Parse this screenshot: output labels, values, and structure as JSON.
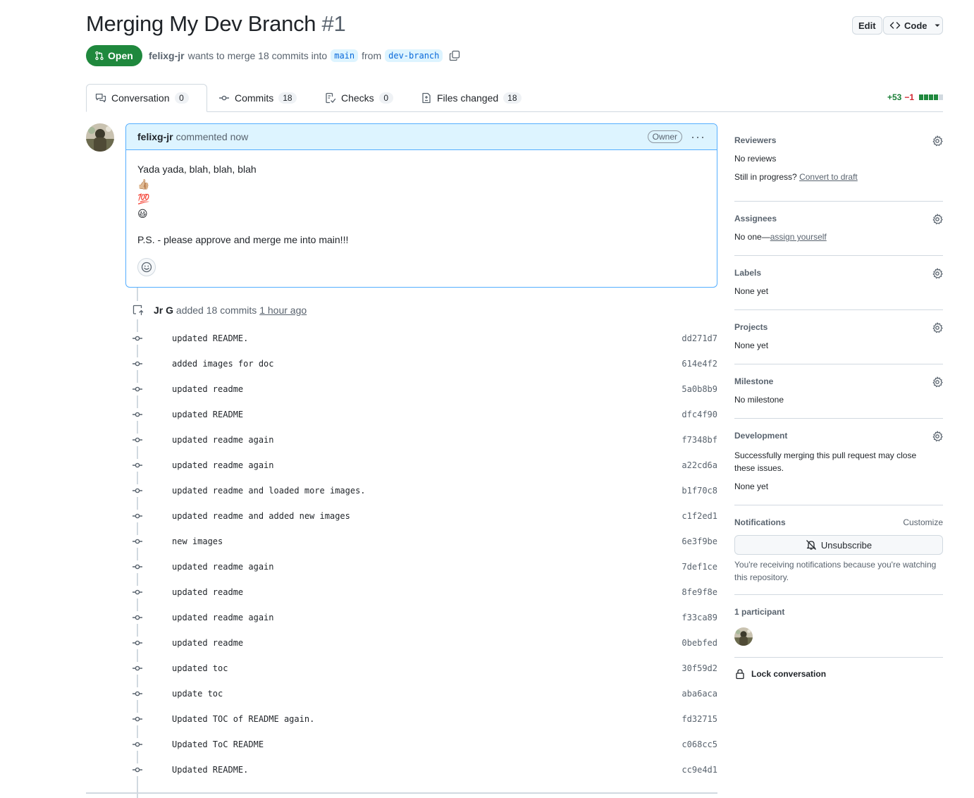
{
  "pr": {
    "title": "Merging My Dev Branch",
    "number": "#1",
    "state": "Open",
    "author": "felixg-jr",
    "merge_text": "wants to merge 18 commits into",
    "base_branch": "main",
    "from_text": "from",
    "head_branch": "dev-branch"
  },
  "header": {
    "edit_label": "Edit",
    "code_label": "Code"
  },
  "tabs": [
    {
      "label": "Conversation",
      "count": "0"
    },
    {
      "label": "Commits",
      "count": "18"
    },
    {
      "label": "Checks",
      "count": "0"
    },
    {
      "label": "Files changed",
      "count": "18"
    }
  ],
  "diffstat": {
    "additions": "+53",
    "deletions": "−1"
  },
  "comment": {
    "author": "felixg-jr",
    "action": "commented now",
    "badge": "Owner",
    "line1": "Yada yada, blah, blah, blah",
    "emoji1": "👍🏼",
    "emoji2": "💯",
    "emoji3": "😃",
    "line2": "P.S. - please approve and merge me into main!!!"
  },
  "push_event": {
    "actor": "Jr G",
    "text": "added 18 commits",
    "time": "1 hour ago"
  },
  "commits": [
    {
      "message": "updated README.",
      "sha": "dd271d7"
    },
    {
      "message": "added images for doc",
      "sha": "614e4f2"
    },
    {
      "message": "updated readme",
      "sha": "5a0b8b9"
    },
    {
      "message": "updated README",
      "sha": "dfc4f90"
    },
    {
      "message": "updated readme again",
      "sha": "f7348bf"
    },
    {
      "message": "updated readme again",
      "sha": "a22cd6a"
    },
    {
      "message": "updated readme and loaded more images.",
      "sha": "b1f70c8"
    },
    {
      "message": "updated readme and added new images",
      "sha": "c1f2ed1"
    },
    {
      "message": "new images",
      "sha": "6e3f9be"
    },
    {
      "message": "updated readme again",
      "sha": "7def1ce"
    },
    {
      "message": "updated readme",
      "sha": "8fe9f8e"
    },
    {
      "message": "updated readme again",
      "sha": "f33ca89"
    },
    {
      "message": "updated readme",
      "sha": "0bebfed"
    },
    {
      "message": "updated toc",
      "sha": "30f59d2"
    },
    {
      "message": "update toc",
      "sha": "aba6aca"
    },
    {
      "message": "Updated TOC of README again.",
      "sha": "fd32715"
    },
    {
      "message": "Updated ToC README",
      "sha": "c068cc5"
    },
    {
      "message": "Updated README.",
      "sha": "cc9e4d1"
    }
  ],
  "sidebar": {
    "reviewers": {
      "title": "Reviewers",
      "value": "No reviews",
      "progress_text": "Still in progress?",
      "convert_link": "Convert to draft"
    },
    "assignees": {
      "title": "Assignees",
      "value": "No one—",
      "assign_link": "assign yourself"
    },
    "labels": {
      "title": "Labels",
      "value": "None yet"
    },
    "projects": {
      "title": "Projects",
      "value": "None yet"
    },
    "milestone": {
      "title": "Milestone",
      "value": "No milestone"
    },
    "development": {
      "title": "Development",
      "description": "Successfully merging this pull request may close these issues.",
      "value": "None yet"
    },
    "notifications": {
      "title": "Notifications",
      "customize": "Customize",
      "unsubscribe": "Unsubscribe",
      "reason": "You're receiving notifications because you're watching this repository."
    },
    "participants": {
      "title": "1 participant"
    },
    "lock": "Lock conversation"
  },
  "colors": {
    "open_green": "#1f883d",
    "accent_blue": "#0969da",
    "comment_header": "#ddf4ff"
  }
}
